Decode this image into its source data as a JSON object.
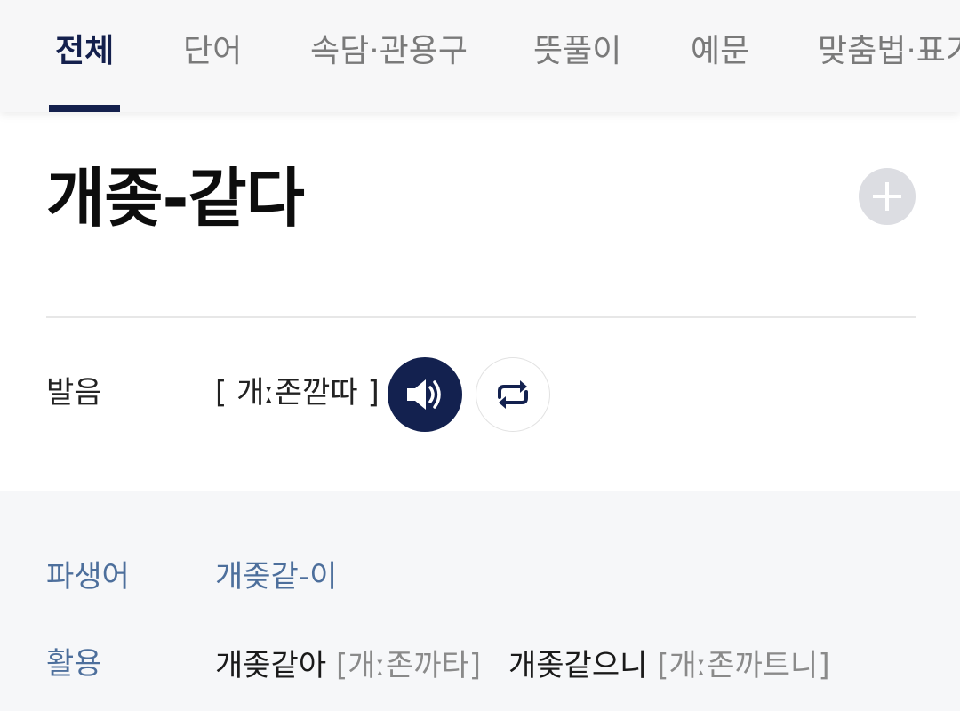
{
  "tabs": [
    {
      "label": "전체"
    },
    {
      "label": "단어"
    },
    {
      "label": "속담·관용구"
    },
    {
      "label": "뜻풀이"
    },
    {
      "label": "예문"
    },
    {
      "label": "맞춤법·표기"
    }
  ],
  "entry": {
    "title": "개좆-같다"
  },
  "pronunciation": {
    "label": "발음",
    "text": "[ 개ː존깓따 ]"
  },
  "derivative": {
    "label": "파생어",
    "value": "개좆같-이"
  },
  "conjugation": {
    "label": "활용",
    "items": [
      {
        "form": "개좆같아",
        "pron": "[개ː존까타]"
      },
      {
        "form": "개좆같으니",
        "pron": "[개ː존까트니]"
      }
    ]
  },
  "colors": {
    "accent": "#14204d",
    "link": "#4d6f9c",
    "panel_bg": "#f6f7f9"
  },
  "icons": [
    "plus-icon",
    "speaker-icon",
    "repeat-icon"
  ]
}
